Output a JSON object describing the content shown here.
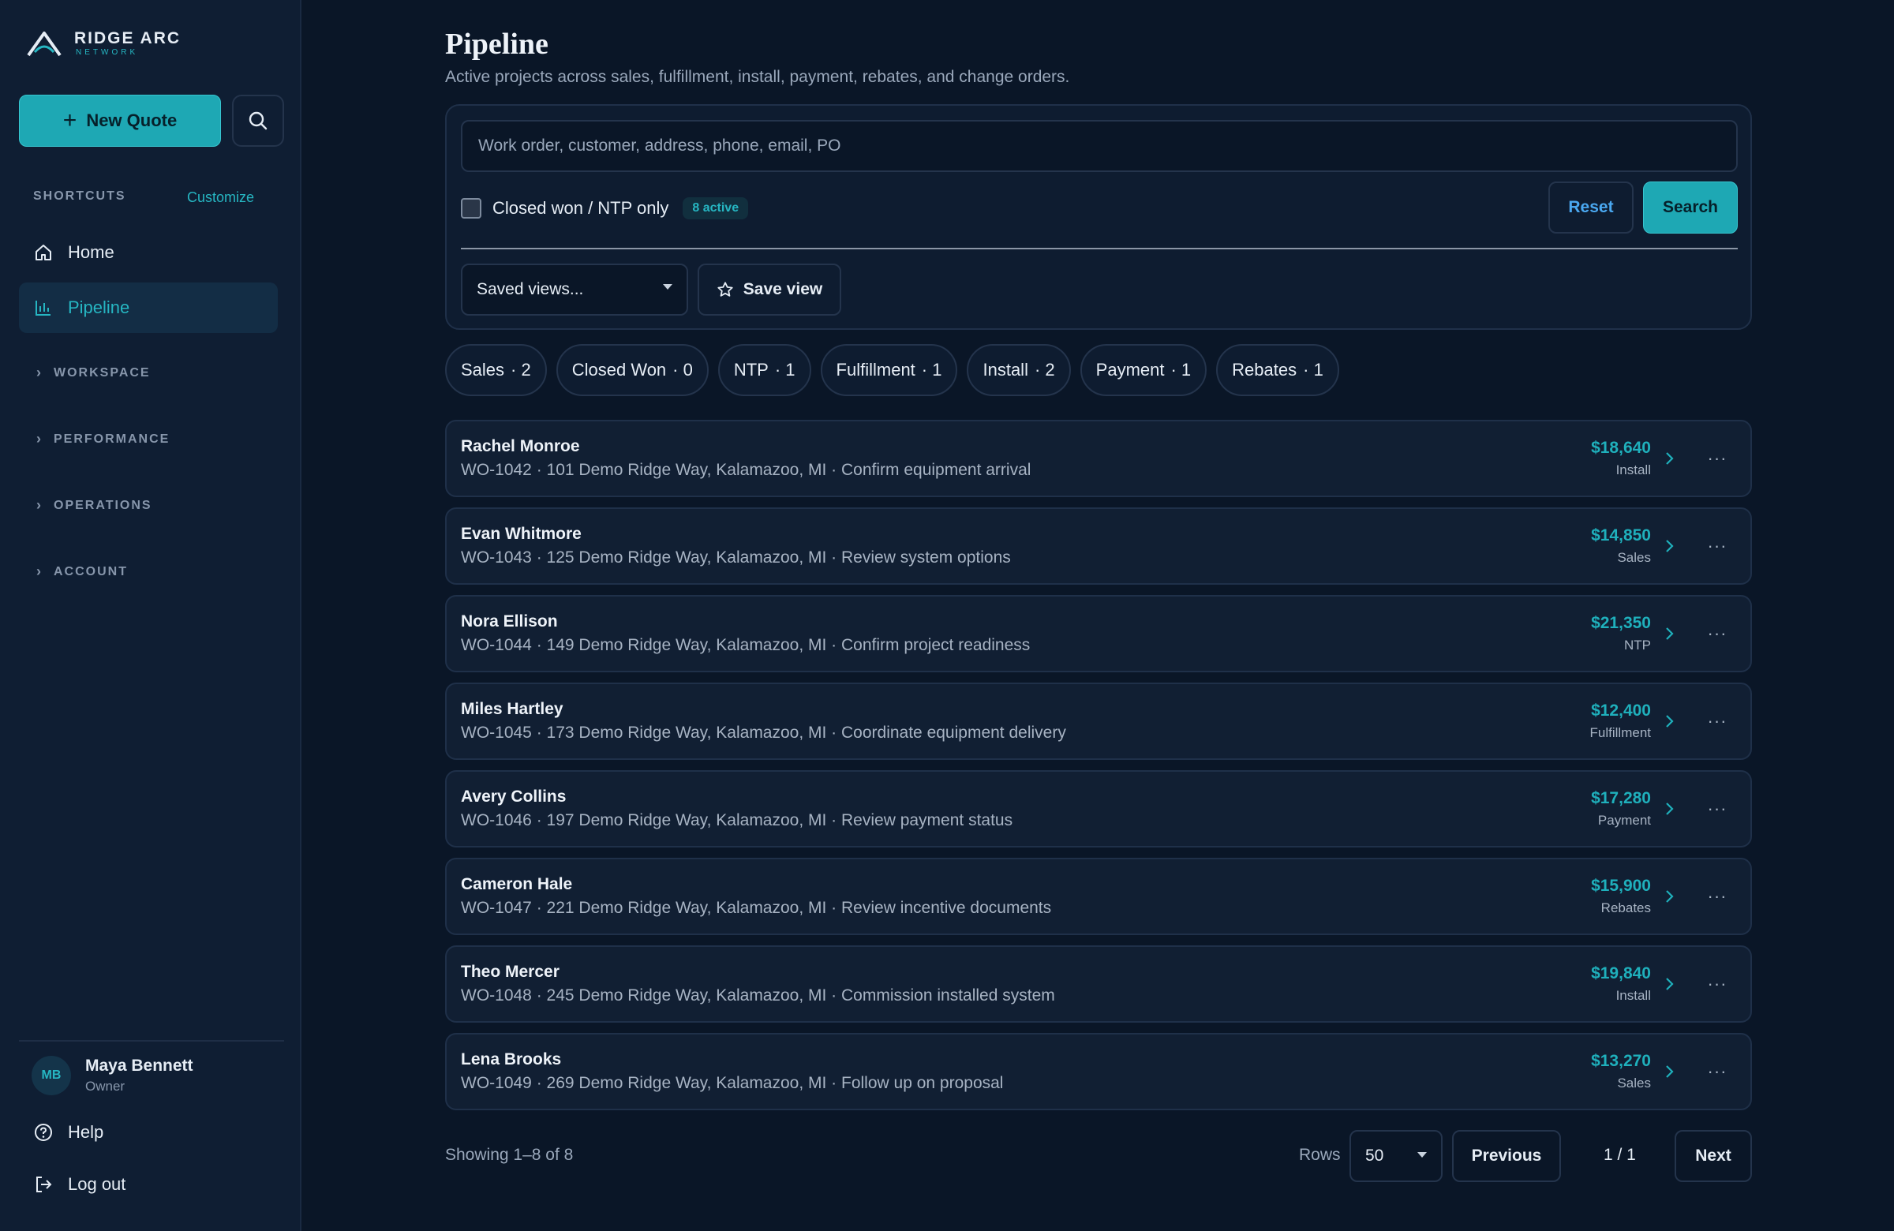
{
  "brand": {
    "title": "RIDGE ARC",
    "subtitle": "NETWORK"
  },
  "sidebar": {
    "new_quote_label": "New Quote",
    "shortcuts_label": "SHORTCUTS",
    "customize_label": "Customize",
    "nav": [
      {
        "label": "Home",
        "icon": "home-icon",
        "active": false
      },
      {
        "label": "Pipeline",
        "icon": "bar-chart-icon",
        "active": true
      }
    ],
    "sections": [
      "WORKSPACE",
      "PERFORMANCE",
      "OPERATIONS",
      "ACCOUNT"
    ],
    "user": {
      "initials": "MB",
      "name": "Maya Bennett",
      "role": "Owner"
    },
    "help_label": "Help",
    "logout_label": "Log out"
  },
  "page": {
    "title": "Pipeline",
    "subtitle": "Active projects across sales, fulfillment, install, payment, rebates, and change orders."
  },
  "filters": {
    "search_placeholder": "Work order, customer, address, phone, email, PO",
    "closed_won_label": "Closed won / NTP only",
    "active_badge": "8 active",
    "reset_label": "Reset",
    "search_label": "Search",
    "saved_views_label": "Saved views...",
    "save_view_label": "Save view"
  },
  "chips": [
    {
      "label": "Sales",
      "count": "· 2"
    },
    {
      "label": "Closed Won",
      "count": "· 0"
    },
    {
      "label": "NTP",
      "count": "· 1"
    },
    {
      "label": "Fulfillment",
      "count": "· 1"
    },
    {
      "label": "Install",
      "count": "· 2"
    },
    {
      "label": "Payment",
      "count": "· 1"
    },
    {
      "label": "Rebates",
      "count": "· 1"
    }
  ],
  "projects": [
    {
      "name": "Rachel Monroe",
      "detail": "WO-1042 · 101 Demo Ridge Way, Kalamazoo, MI · Confirm equipment arrival",
      "amount": "$18,640",
      "stage": "Install"
    },
    {
      "name": "Evan Whitmore",
      "detail": "WO-1043 · 125 Demo Ridge Way, Kalamazoo, MI · Review system options",
      "amount": "$14,850",
      "stage": "Sales"
    },
    {
      "name": "Nora Ellison",
      "detail": "WO-1044 · 149 Demo Ridge Way, Kalamazoo, MI · Confirm project readiness",
      "amount": "$21,350",
      "stage": "NTP"
    },
    {
      "name": "Miles Hartley",
      "detail": "WO-1045 · 173 Demo Ridge Way, Kalamazoo, MI · Coordinate equipment delivery",
      "amount": "$12,400",
      "stage": "Fulfillment"
    },
    {
      "name": "Avery Collins",
      "detail": "WO-1046 · 197 Demo Ridge Way, Kalamazoo, MI · Review payment status",
      "amount": "$17,280",
      "stage": "Payment"
    },
    {
      "name": "Cameron Hale",
      "detail": "WO-1047 · 221 Demo Ridge Way, Kalamazoo, MI · Review incentive documents",
      "amount": "$15,900",
      "stage": "Rebates"
    },
    {
      "name": "Theo Mercer",
      "detail": "WO-1048 · 245 Demo Ridge Way, Kalamazoo, MI · Commission installed system",
      "amount": "$19,840",
      "stage": "Install"
    },
    {
      "name": "Lena Brooks",
      "detail": "WO-1049 · 269 Demo Ridge Way, Kalamazoo, MI · Follow up on proposal",
      "amount": "$13,270",
      "stage": "Sales"
    }
  ],
  "pagination": {
    "showing": "Showing 1–8 of 8",
    "rows_label": "Rows",
    "rows_value": "50",
    "previous_label": "Previous",
    "page_indicator": "1 / 1",
    "next_label": "Next"
  },
  "colors": {
    "accent": "#1ea8b4",
    "background": "#0a1627",
    "sidebar": "#0f1e33",
    "link": "#4aa8f0"
  }
}
